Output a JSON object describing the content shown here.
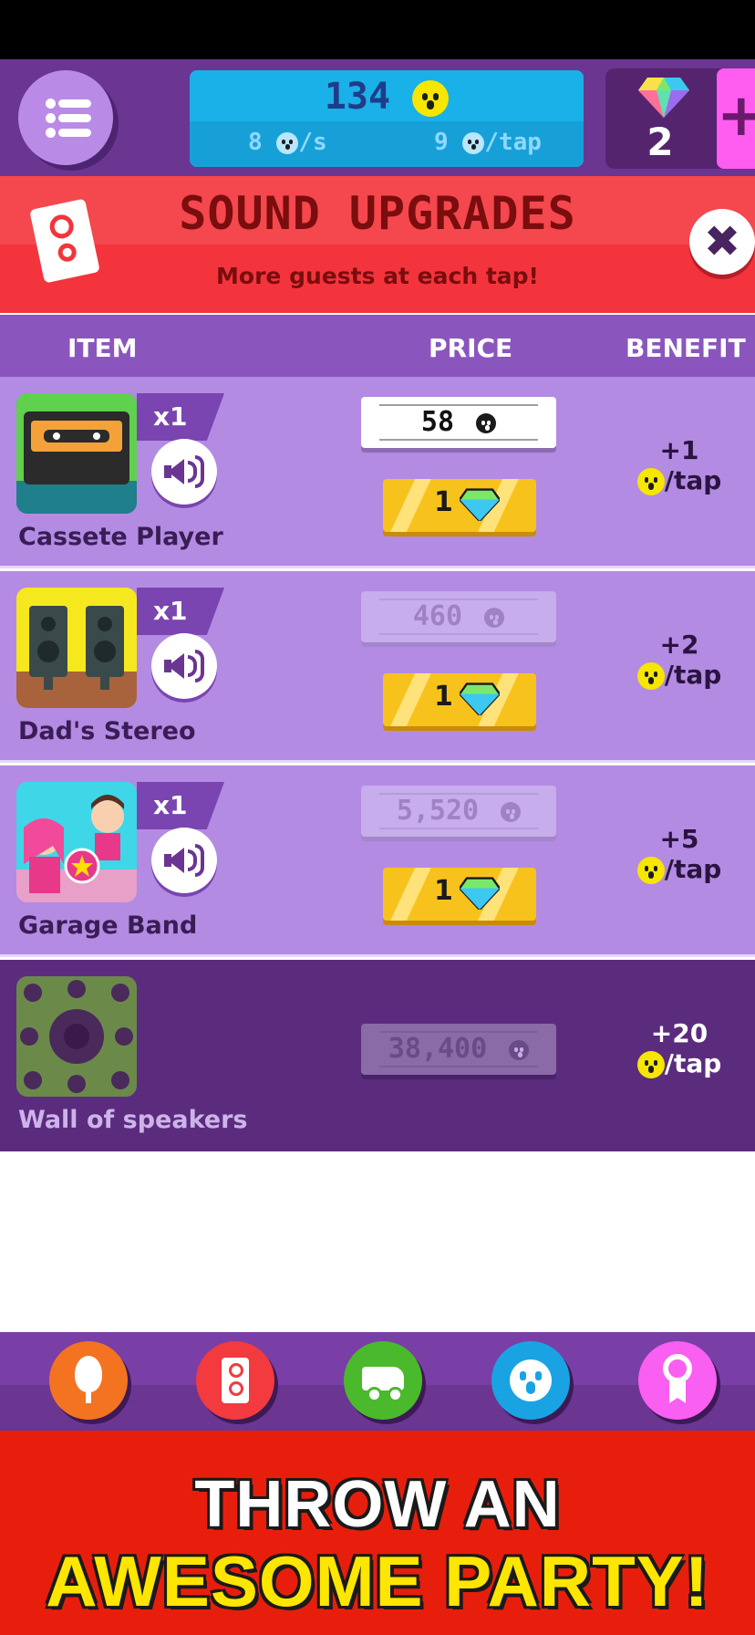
{
  "stats": {
    "guests": "134",
    "per_second": "8",
    "per_second_unit": "/s",
    "per_tap": "9",
    "per_tap_unit": "/tap",
    "gems": "2",
    "add_gems_label": "+"
  },
  "header": {
    "title": "SOUND UPGRADES",
    "subtitle": "More guests at each tap!",
    "close_label": "✖"
  },
  "columns": {
    "item": "ITEM",
    "price": "PRICE",
    "benefit": "BENEFIT"
  },
  "items": [
    {
      "name": "Cassete Player",
      "quantity": "x1",
      "price": "58",
      "gem_price": "1",
      "benefit_amount": "+1",
      "benefit_unit": "/tap",
      "affordable": true,
      "locked": false
    },
    {
      "name": "Dad's Stereo",
      "quantity": "x1",
      "price": "460",
      "gem_price": "1",
      "benefit_amount": "+2",
      "benefit_unit": "/tap",
      "affordable": false,
      "locked": false
    },
    {
      "name": "Garage Band",
      "quantity": "x1",
      "price": "5,520",
      "gem_price": "1",
      "benefit_amount": "+5",
      "benefit_unit": "/tap",
      "affordable": false,
      "locked": false
    },
    {
      "name": "Wall of speakers",
      "price": "38,400",
      "benefit_amount": "+20",
      "benefit_unit": "/tap",
      "affordable": false,
      "locked": true
    }
  ],
  "nav": [
    {
      "icon": "balloon-icon",
      "color": "#f47321"
    },
    {
      "icon": "speaker-icon",
      "color": "#f23a3f"
    },
    {
      "icon": "van-icon",
      "color": "#4ab92c"
    },
    {
      "icon": "guest-face-icon",
      "color": "#1aa3e3"
    },
    {
      "icon": "ribbon-icon",
      "color": "#f95ff0"
    }
  ],
  "promo": {
    "line1": "THROW AN",
    "line2": "AWESOME PARTY!"
  },
  "colors": {
    "topbar": "#6b3592",
    "header_red": "#f3343c",
    "row_purple": "#b38be3",
    "locked_row": "#5b2c7e",
    "promo_red": "#e81e0c",
    "promo_yellow": "#ffe600"
  }
}
